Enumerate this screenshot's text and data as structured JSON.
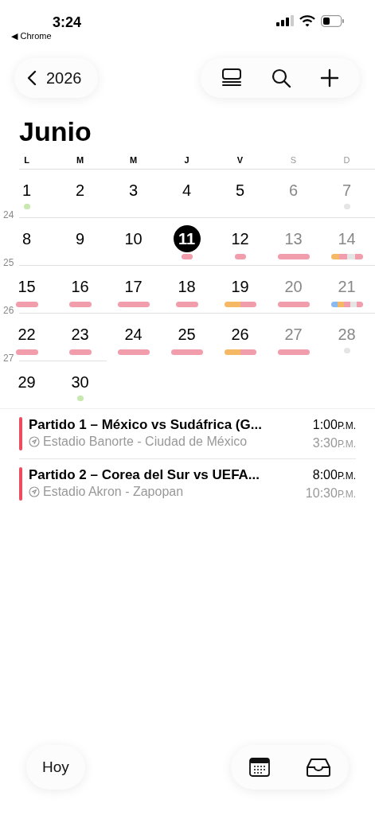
{
  "status_bar": {
    "time": "3:24",
    "back_app": "◀ Chrome"
  },
  "toolbar": {
    "back_label": "2026"
  },
  "month_title": "Junio",
  "weekdays": [
    {
      "label": "L",
      "weekend": false
    },
    {
      "label": "M",
      "weekend": false
    },
    {
      "label": "M",
      "weekend": false
    },
    {
      "label": "J",
      "weekend": false
    },
    {
      "label": "V",
      "weekend": false
    },
    {
      "label": "S",
      "weekend": true
    },
    {
      "label": "D",
      "weekend": true
    }
  ],
  "weeks": [
    {
      "days": [
        {
          "day": "1",
          "weekend": false,
          "selected": false,
          "marker": {
            "kind": "dot",
            "segments": [
              {
                "color": "#c8e8b0"
              }
            ]
          }
        },
        {
          "day": "2",
          "weekend": false,
          "selected": false
        },
        {
          "day": "3",
          "weekend": false,
          "selected": false
        },
        {
          "day": "4",
          "weekend": false,
          "selected": false
        },
        {
          "day": "5",
          "weekend": false,
          "selected": false
        },
        {
          "day": "6",
          "weekend": true,
          "selected": false
        },
        {
          "day": "7",
          "weekend": true,
          "selected": false,
          "marker": {
            "kind": "dot",
            "segments": [
              {
                "color": "#e5e5e5"
              }
            ]
          }
        }
      ]
    },
    {
      "week_number": "24",
      "days": [
        {
          "day": "8",
          "weekend": false,
          "selected": false
        },
        {
          "day": "9",
          "weekend": false,
          "selected": false
        },
        {
          "day": "10",
          "weekend": false,
          "selected": false
        },
        {
          "day": "11",
          "weekend": false,
          "selected": true,
          "marker": {
            "kind": "short",
            "segments": [
              {
                "color": "#f29dab"
              }
            ]
          }
        },
        {
          "day": "12",
          "weekend": false,
          "selected": false,
          "marker": {
            "kind": "short",
            "segments": [
              {
                "color": "#f29dab"
              }
            ]
          }
        },
        {
          "day": "13",
          "weekend": true,
          "selected": false,
          "marker": {
            "kind": "long",
            "segments": [
              {
                "color": "#f29dab"
              }
            ]
          }
        },
        {
          "day": "14",
          "weekend": true,
          "selected": false,
          "marker": {
            "kind": "long",
            "segments": [
              {
                "color": "#f5b865"
              },
              {
                "color": "#f29dab"
              },
              {
                "color": "#e5e5e5"
              },
              {
                "color": "#f29dab"
              }
            ]
          }
        }
      ]
    },
    {
      "week_number": "25",
      "days": [
        {
          "day": "15",
          "weekend": false,
          "selected": false,
          "marker": {
            "kind": "medium",
            "segments": [
              {
                "color": "#f29dab"
              }
            ]
          }
        },
        {
          "day": "16",
          "weekend": false,
          "selected": false,
          "marker": {
            "kind": "medium",
            "segments": [
              {
                "color": "#f29dab"
              }
            ]
          }
        },
        {
          "day": "17",
          "weekend": false,
          "selected": false,
          "marker": {
            "kind": "long",
            "segments": [
              {
                "color": "#f29dab"
              }
            ]
          }
        },
        {
          "day": "18",
          "weekend": false,
          "selected": false,
          "marker": {
            "kind": "medium",
            "segments": [
              {
                "color": "#f29dab"
              }
            ]
          }
        },
        {
          "day": "19",
          "weekend": false,
          "selected": false,
          "marker": {
            "kind": "long",
            "segments": [
              {
                "color": "#f5b865"
              },
              {
                "color": "#f29dab"
              }
            ]
          }
        },
        {
          "day": "20",
          "weekend": true,
          "selected": false,
          "marker": {
            "kind": "long",
            "segments": [
              {
                "color": "#f29dab"
              }
            ]
          }
        },
        {
          "day": "21",
          "weekend": true,
          "selected": false,
          "marker": {
            "kind": "long",
            "segments": [
              {
                "color": "#8ab8f0"
              },
              {
                "color": "#f5b865"
              },
              {
                "color": "#f29dab"
              },
              {
                "color": "#e5e5e5"
              },
              {
                "color": "#f29dab"
              }
            ]
          }
        }
      ]
    },
    {
      "week_number": "26",
      "days": [
        {
          "day": "22",
          "weekend": false,
          "selected": false,
          "marker": {
            "kind": "medium",
            "segments": [
              {
                "color": "#f29dab"
              }
            ]
          }
        },
        {
          "day": "23",
          "weekend": false,
          "selected": false,
          "marker": {
            "kind": "medium",
            "segments": [
              {
                "color": "#f29dab"
              }
            ]
          }
        },
        {
          "day": "24",
          "weekend": false,
          "selected": false,
          "marker": {
            "kind": "long",
            "segments": [
              {
                "color": "#f29dab"
              }
            ]
          }
        },
        {
          "day": "25",
          "weekend": false,
          "selected": false,
          "marker": {
            "kind": "long",
            "segments": [
              {
                "color": "#f29dab"
              }
            ]
          }
        },
        {
          "day": "26",
          "weekend": false,
          "selected": false,
          "marker": {
            "kind": "long",
            "segments": [
              {
                "color": "#f5b865"
              },
              {
                "color": "#f29dab"
              }
            ]
          }
        },
        {
          "day": "27",
          "weekend": true,
          "selected": false,
          "marker": {
            "kind": "long",
            "segments": [
              {
                "color": "#f29dab"
              }
            ]
          }
        },
        {
          "day": "28",
          "weekend": true,
          "selected": false,
          "marker": {
            "kind": "dot",
            "segments": [
              {
                "color": "#e5e5e5"
              }
            ]
          }
        }
      ]
    },
    {
      "week_number": "27",
      "days": [
        {
          "day": "29",
          "weekend": false,
          "selected": false
        },
        {
          "day": "30",
          "weekend": false,
          "selected": false,
          "marker": {
            "kind": "dot",
            "segments": [
              {
                "color": "#c8e8b0"
              }
            ]
          }
        }
      ]
    }
  ],
  "events": [
    {
      "title": "Partido 1 – México vs Sudáfrica (G...",
      "location": "Estadio Banorte - Ciudad de México",
      "start": "1:00",
      "start_suffix": "P.M.",
      "end": "3:30",
      "end_suffix": "P.M.",
      "color": "#eb4d5f"
    },
    {
      "title": "Partido 2 – Corea del Sur vs UEFA...",
      "location": "Estadio Akron - Zapopan",
      "start": "8:00",
      "start_suffix": "P.M.",
      "end": "10:30",
      "end_suffix": "P.M.",
      "color": "#eb4d5f"
    }
  ],
  "bottom_bar": {
    "today_label": "Hoy"
  }
}
